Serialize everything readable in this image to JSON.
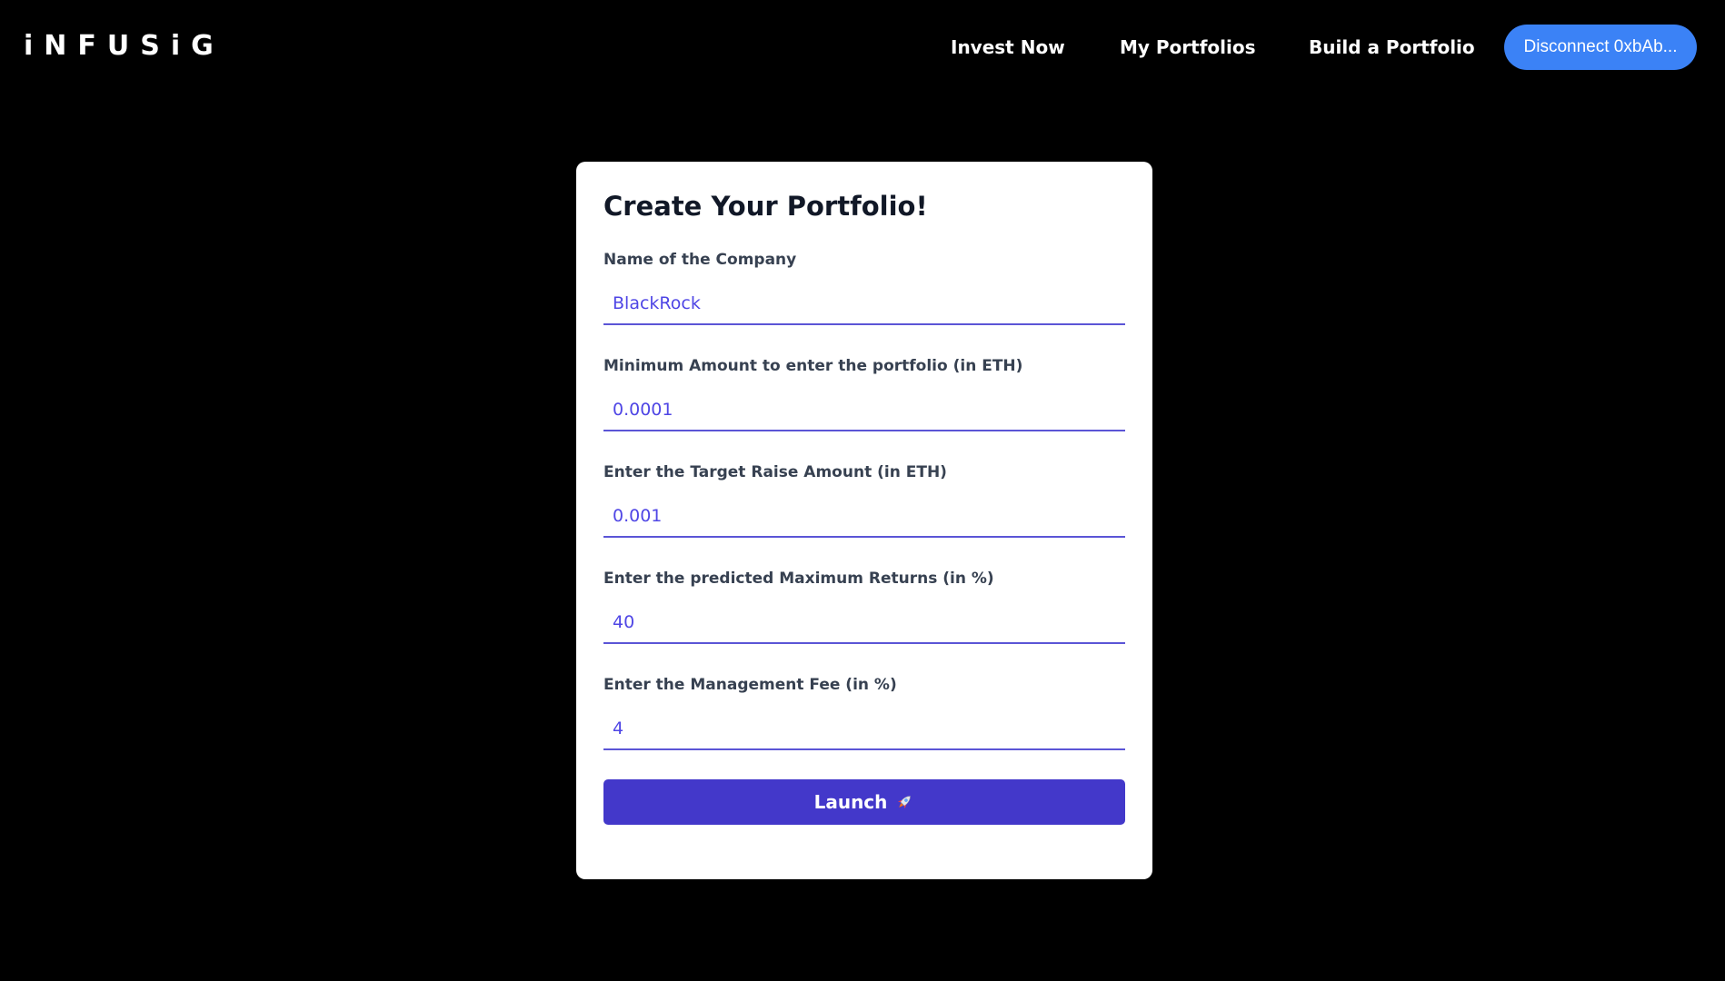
{
  "brand": {
    "logo_text": "iNFUSiG"
  },
  "nav": {
    "items": [
      {
        "label": "Invest Now"
      },
      {
        "label": "My Portfolios"
      },
      {
        "label": "Build a Portfolio"
      }
    ],
    "disconnect_label": "Disconnect 0xbAb..."
  },
  "form": {
    "title": "Create Your Portfolio!",
    "fields": [
      {
        "label": "Name of the Company",
        "value": "BlackRock"
      },
      {
        "label": "Minimum Amount to enter the portfolio (in ETH)",
        "value": "0.0001"
      },
      {
        "label": "Enter the Target Raise Amount (in ETH)",
        "value": "0.001"
      },
      {
        "label": "Enter the predicted Maximum Returns (in %)",
        "value": "40"
      },
      {
        "label": "Enter the Management Fee (in %)",
        "value": "4"
      }
    ],
    "submit_label": "Launch",
    "submit_icon": "rocket-icon"
  },
  "colors": {
    "background": "#000000",
    "accent_button": "#4338ca",
    "disconnect_button": "#3b82f6",
    "input_text": "#4f46e5"
  }
}
